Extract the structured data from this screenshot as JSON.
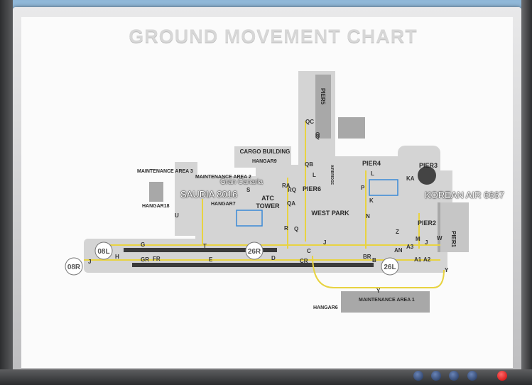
{
  "chart": {
    "title": "GROUND MOVEMENT CHART"
  },
  "aircraft_labels": {
    "saudia": "SAUDIA 8016",
    "gran_canaria": "Gran Canaria",
    "korean": "KOREAN AIR 6667"
  },
  "areas": {
    "cargo_building": "CARGO BUILDING",
    "hangar9": "HANGAR9",
    "hangar7": "HANGAR7",
    "hangar18": "HANGAR18",
    "hangar6": "HANGAR6",
    "maintenance_area_3": "MAINTENANCE AREA 3",
    "maintenance_area_2": "MAINTENANCE AREA 2",
    "maintenance_area_1": "MAINTENANCE AREA 1",
    "atc_tower_1": "ATC",
    "atc_tower_2": "TOWER",
    "west_park": "WEST PARK",
    "pier1": "PIER1",
    "pier2": "PIER2",
    "pier3": "PIER3",
    "pier4": "PIER4",
    "pier5": "PIER5",
    "pier6": "PIER6",
    "airbridge": "AIRBRIDGE"
  },
  "runways": {
    "r08L": "08L",
    "r26R": "26R",
    "r08R": "08R",
    "r26L": "26L"
  },
  "taxiways": [
    "QC",
    "Q",
    "QB",
    "L",
    "RA",
    "RQ",
    "QA",
    "R",
    "Q",
    "C",
    "D",
    "CR",
    "BR",
    "B",
    "J",
    "T",
    "E",
    "G",
    "GR",
    "FR",
    "H",
    "J",
    "U",
    "P",
    "N",
    "L",
    "K",
    "KA",
    "Z",
    "M",
    "W",
    "AN",
    "A3",
    "J",
    "A1",
    "A2",
    "Y",
    "Y",
    "S",
    "Q"
  ],
  "colors": {
    "taxi_line": "#e8d341",
    "pavement": "#d2d2d2",
    "building": "#a9a9a9",
    "runway": "#3a3a3a"
  }
}
